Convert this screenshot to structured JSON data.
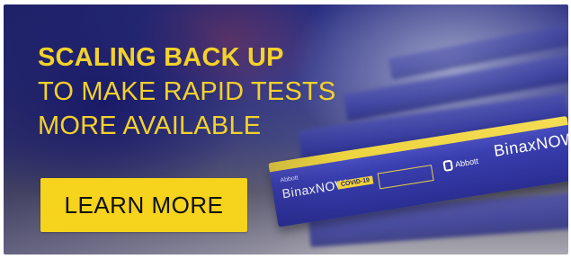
{
  "headline": {
    "line1": "SCALING BACK UP",
    "line2": "TO MAKE RAPID TESTS",
    "line3": "MORE AVAILABLE"
  },
  "cta": {
    "label": "LEARN MORE"
  },
  "product_box": {
    "maker_small": "Abbott",
    "brand_left": "BinaxNOW",
    "covid_tag": "COVID-19",
    "maker_logo": "Abbott",
    "brand_right": "BinaxNOW"
  },
  "colors": {
    "headline": "#f3d22b",
    "cta_background": "#f6d31c",
    "cta_text": "#111111",
    "box_blue": "#3a3fb0"
  }
}
